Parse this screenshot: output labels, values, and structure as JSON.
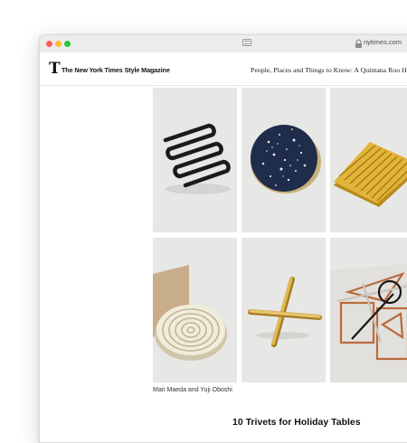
{
  "browser": {
    "url": "nytimes.com",
    "icons": [
      "reader-view-icon",
      "lock-icon"
    ]
  },
  "header": {
    "logo_letter": "T",
    "masthead": "The New York Times Style Magazine",
    "headline": "People, Places and Things to Know: A Quintana Roo Hotel"
  },
  "gallery": {
    "items": [
      "black zigzag wire trivet",
      "navy terrazzo round trivet",
      "yellow ribbed square trivet",
      "white spiral trivet",
      "brass cross trivet",
      "copper geometric wire trivet"
    ],
    "caption": "Mari Maeda and Yuji Oboshi"
  },
  "article": {
    "title": "10 Trivets for Holiday Tables"
  },
  "colors": {
    "close": "#fe5f57",
    "minimize": "#febc2e",
    "zoom": "#28c840",
    "photo_background": "#e7e7e5"
  }
}
